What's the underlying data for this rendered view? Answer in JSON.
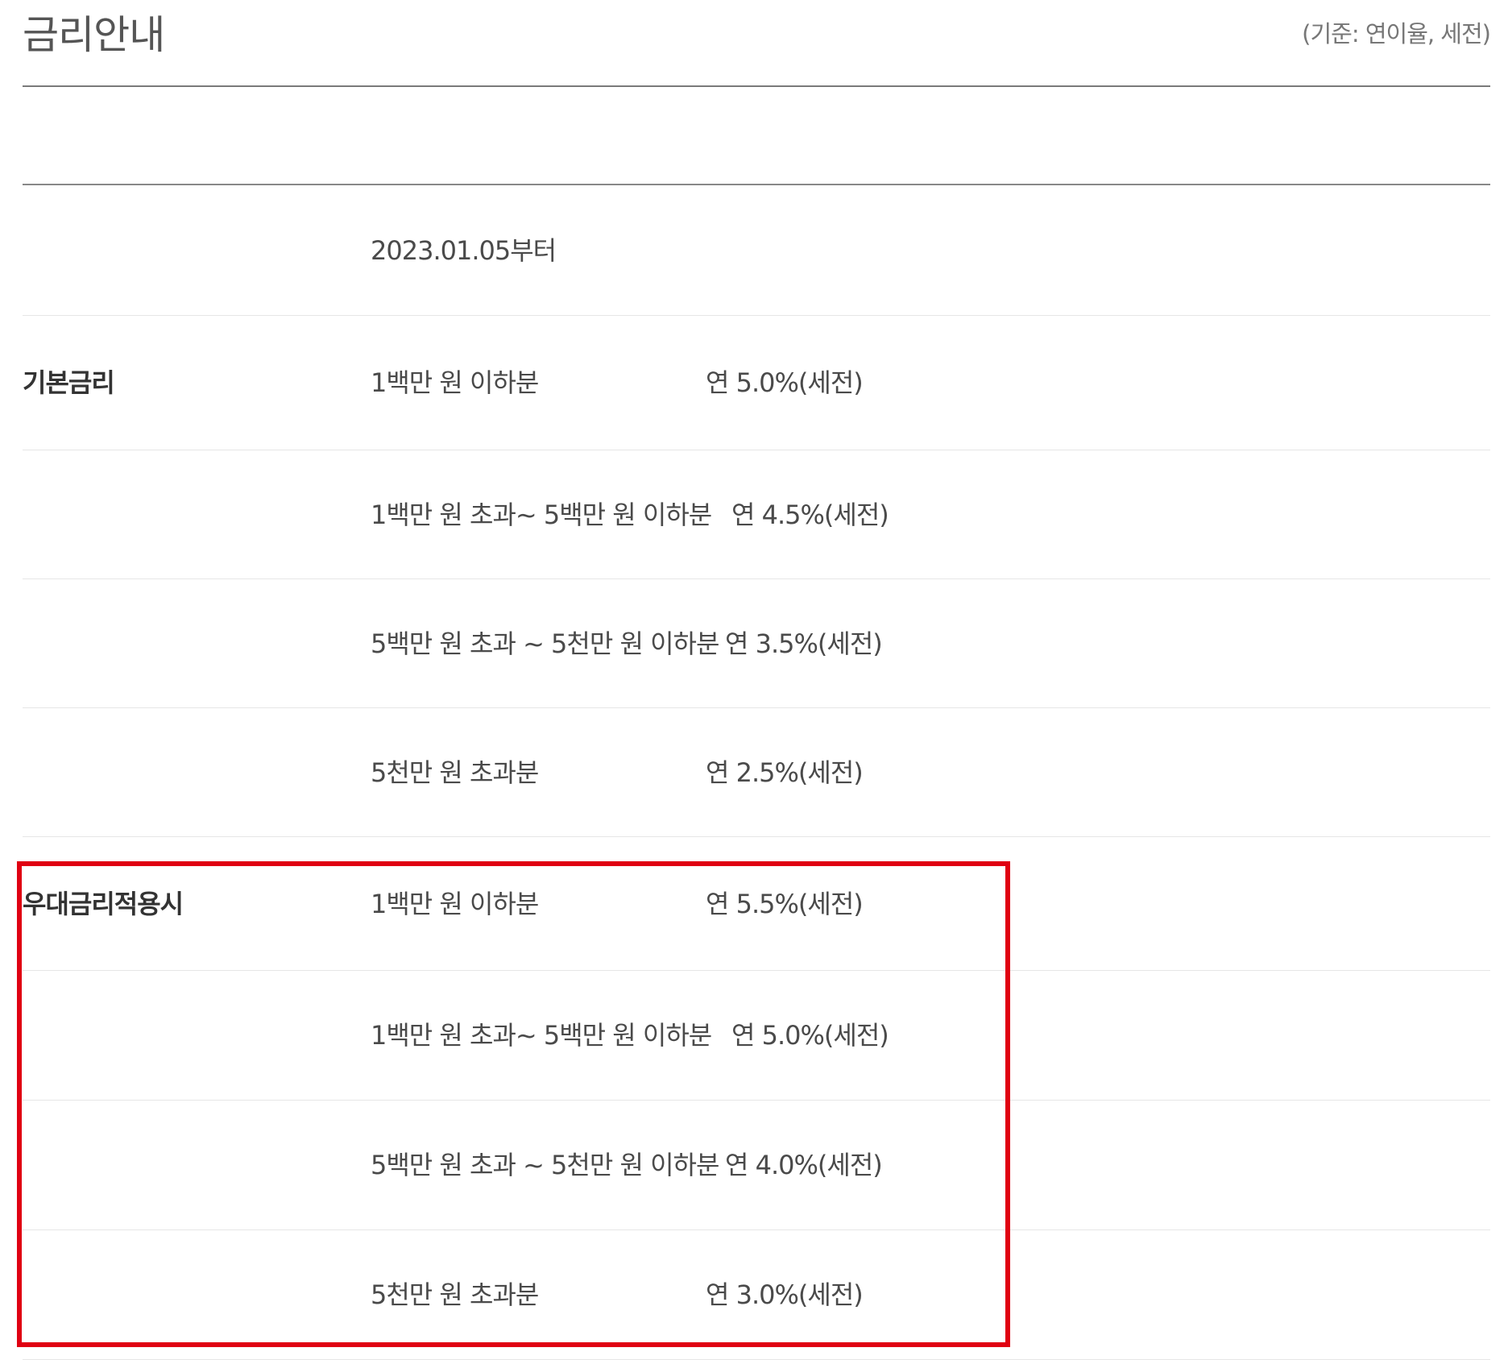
{
  "header": {
    "title": "금리안내",
    "basis_note": "(기준: 연이율, 세전)"
  },
  "table": {
    "effective_date": "2023.01.05부터",
    "base_rate": {
      "category": "기본금리",
      "rows": [
        {
          "range": "1백만 원 이하분",
          "rate": "연 5.0%(세전)"
        },
        {
          "range": "1백만 원  초과~  5백만 원 이하분",
          "rate": "연 4.5%(세전)"
        },
        {
          "range": "5백만 원  초과 ~  5천만 원 이하분",
          "rate": "연 3.5%(세전)"
        },
        {
          "range": "5천만 원  초과분",
          "rate": "연 2.5%(세전)"
        }
      ]
    },
    "preferential_rate": {
      "category": "우대금리적용시",
      "rows": [
        {
          "range": "1백만 원 이하분",
          "rate": "연 5.5%(세전)"
        },
        {
          "range": "1백만 원  초과~  5백만 원 이하분",
          "rate": "연 5.0%(세전)"
        },
        {
          "range": "5백만 원  초과 ~  5천만 원 이하분",
          "rate": "연 4.0%(세전)"
        },
        {
          "range": "5천만 원 초과분",
          "rate": "연 3.0%(세전)"
        }
      ]
    }
  },
  "colors": {
    "highlight_border": "#e00012",
    "text": "#4a4a4a",
    "rule": "#888888"
  }
}
